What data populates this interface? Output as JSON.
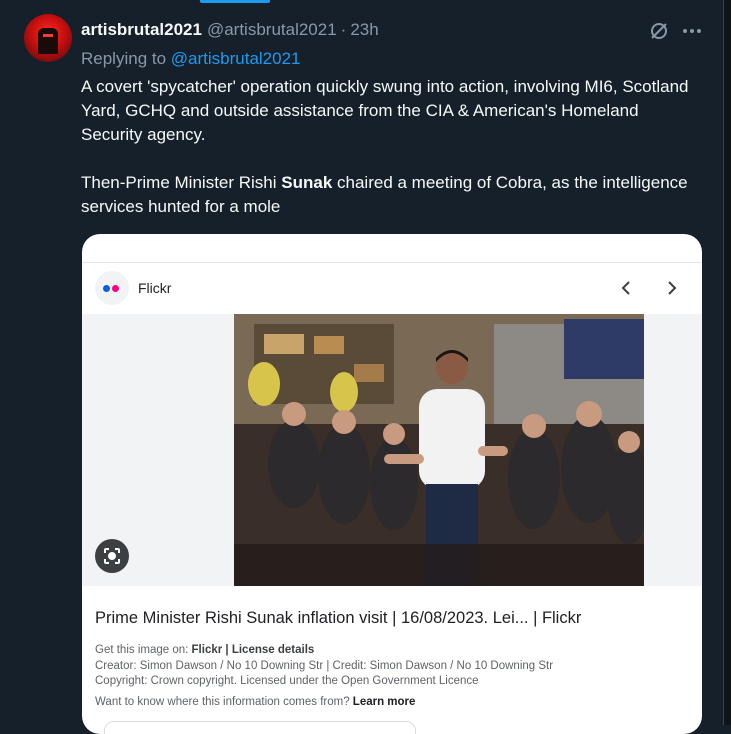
{
  "tweet": {
    "display_name": "artisbrutal2021",
    "handle": "@artisbrutal2021",
    "separator": "·",
    "time": "23h",
    "replying_prefix": "Replying to ",
    "replying_to": "@artisbrutal2021",
    "paragraph1": "A covert 'spycatcher' operation quickly  swung into action, involving MI6, Scotland Yard, GCHQ and outside  assistance from the CIA & American's Homeland Security agency.",
    "paragraph2_before": "Then-Prime  Minister Rishi ",
    "paragraph2_bold": "Sunak",
    "paragraph2_after": " chaired a meeting of Cobra, as the intelligence services hunted for a mole",
    "icons": [
      "grok-icon",
      "more-icon"
    ]
  },
  "card": {
    "source_name": "Flickr",
    "title": "Prime Minister Rishi Sunak inflation visit | 16/08/2023. Lei... | Flickr",
    "get_image_prefix": "Get this image on: ",
    "get_image_source": "Flickr",
    "separator": " | ",
    "license_details": "License details",
    "creator_line": "Creator: Simon Dawson / No 10 Downing Str | Credit: Simon Dawson / No 10 Downing Str",
    "copyright_line": "Copyright: Crown copyright. Licensed under the Open Government Licence",
    "want_to_know": "Want to know where this information comes from? ",
    "learn_more": "Learn more",
    "icons": [
      "flickr-logo-icon",
      "chevron-left-icon",
      "chevron-right-icon",
      "lens-icon"
    ]
  },
  "colors": {
    "background": "#15202b",
    "text_primary": "#f7f9f9",
    "text_secondary": "#8b98a5",
    "accent": "#1d9bf0",
    "flickr_blue": "#0063dc",
    "flickr_pink": "#ff0084"
  }
}
